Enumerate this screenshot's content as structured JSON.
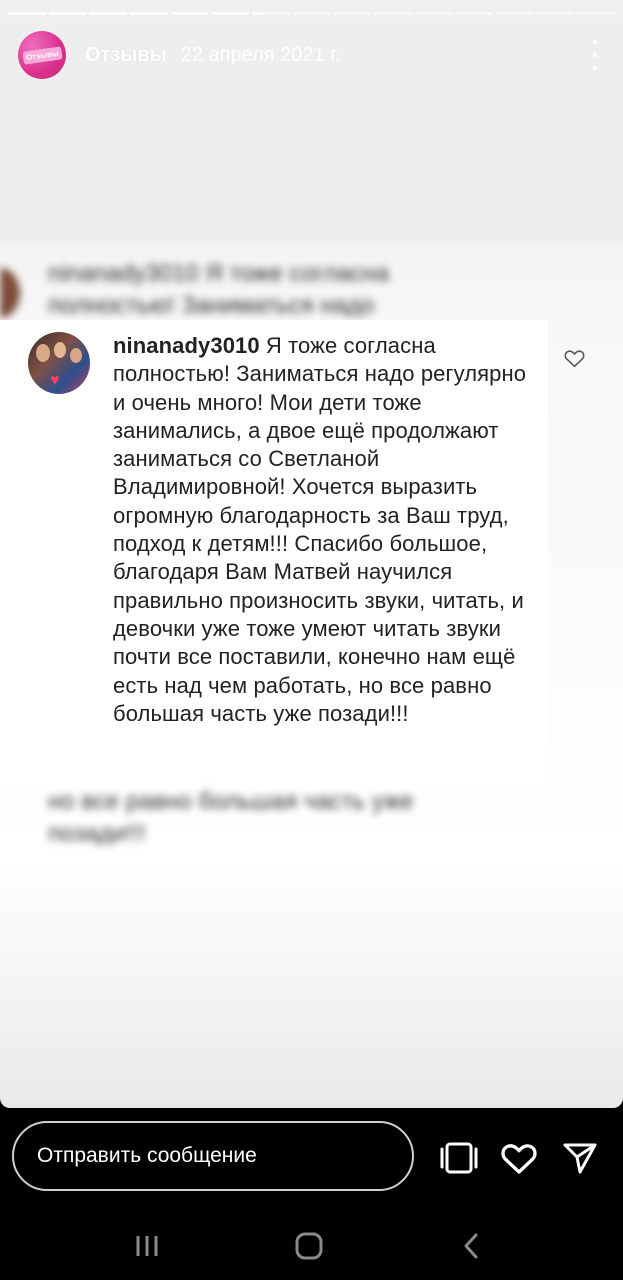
{
  "story": {
    "title": "Отзывы",
    "date": "22 апреля 2021 г.",
    "avatar_badge": "Отзывы",
    "progress": {
      "segments": 15,
      "completed": 6,
      "current_fraction": 0.3
    }
  },
  "comment": {
    "username": "ninanady3010",
    "text": " Я тоже согласна полностью! Заниматься надо регулярно и очень много! Мои дети тоже занимались, а двое ещё продолжают заниматься со Светланой Владимировной! Хочется выразить огромную благодарность за Ваш труд, подход к детям!!! Спасибо большое, благодаря Вам Матвей научился правильно произносить звуки, читать, и девочки уже тоже умеют читать звуки почти все поставили, конечно нам ещё есть над чем работать, но все равно большая часть уже позади!!!",
    "like_icon": "heart-outline-icon"
  },
  "blurred": {
    "top_line1": "ninanady3010 Я тоже согласна",
    "top_line2": "полностью! Заниматься надо",
    "bottom_line1": "но все равно большая часть уже",
    "bottom_line2": "позади!!!"
  },
  "bottom": {
    "message_placeholder": "Отправить сообщение",
    "icons": [
      "sticker-icon",
      "heart-icon",
      "send-icon"
    ]
  },
  "colors": {
    "accent": "#d92f8c",
    "background": "#000000"
  }
}
